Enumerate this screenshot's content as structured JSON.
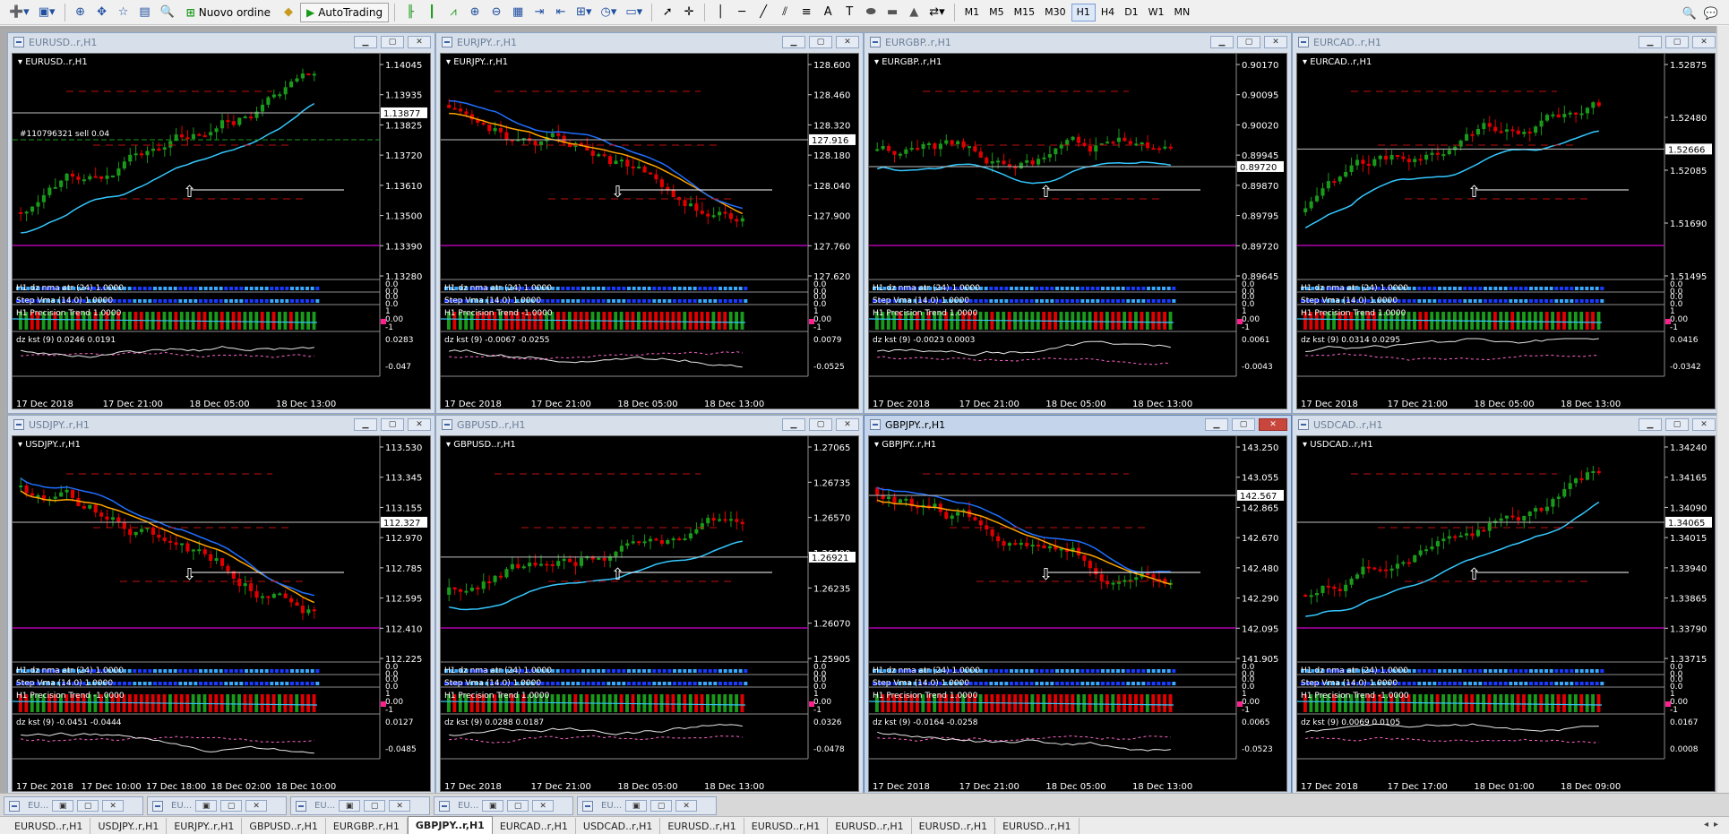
{
  "toolbar": {
    "new_order": "Nuovo ordine",
    "autotrading": "AutoTrading",
    "timeframes": [
      "M1",
      "M5",
      "M15",
      "M30",
      "H1",
      "H4",
      "D1",
      "W1",
      "MN"
    ],
    "active_timeframe": "H1"
  },
  "windows": [
    {
      "title": "EURUSD..r,H1",
      "chart_symbol": "EURUSD..r,H1",
      "bid": "1.13877",
      "prices": [
        "1.14045",
        "1.13935",
        "1.13825",
        "1.13720",
        "1.13610",
        "1.13500",
        "1.13390",
        "1.13280"
      ],
      "order_label": "#110796321 sell 0.04",
      "ind1": "H1 dz nma atr (24) 1.0000",
      "ind1_v": [
        "0.0",
        "0.0"
      ],
      "ind2": "Step Vma (14.0) 1.0000",
      "ind2_v": [
        "0.0",
        "0.0"
      ],
      "ind3": "H1 Precision Trend 1.0000",
      "ind3_v": [
        "1",
        "0.00",
        "-1"
      ],
      "ind4": "dz kst (9) 0.0246 0.0191",
      "ind4_v": [
        "0.0283",
        "-0.047"
      ],
      "dates": [
        "17 Dec 2018",
        "17 Dec 21:00",
        "18 Dec 05:00",
        "18 Dec 13:00"
      ]
    },
    {
      "title": "EURJPY..r,H1",
      "chart_symbol": "EURJPY..r,H1",
      "bid": "127.916",
      "prices": [
        "128.600",
        "128.460",
        "128.320",
        "128.180",
        "128.040",
        "127.900",
        "127.760",
        "127.620"
      ],
      "ind1": "H1 dz nma atr (24) 1.0000",
      "ind1_v": [
        "0.0",
        "0.0"
      ],
      "ind2": "Step Vma (14.0) 1.0000",
      "ind2_v": [
        "0.0",
        "0.0"
      ],
      "ind3": "H1 Precision Trend -1.0000",
      "ind3_v": [
        "1",
        "0.00",
        "-1"
      ],
      "ind4": "dz kst (9) -0.0067 -0.0255",
      "ind4_v": [
        "0.0079",
        "-0.0525"
      ],
      "dates": [
        "17 Dec 2018",
        "17 Dec 21:00",
        "18 Dec 05:00",
        "18 Dec 13:00"
      ]
    },
    {
      "title": "EURGBP..r,H1",
      "chart_symbol": "EURGBP..r,H1",
      "bid": "0.89720",
      "prices": [
        "0.90170",
        "0.90095",
        "0.90020",
        "0.89945",
        "0.89870",
        "0.89795",
        "0.89720",
        "0.89645"
      ],
      "ind1": "H1 dz nma atr (24) 1.0000",
      "ind1_v": [
        "0.0",
        "0.0"
      ],
      "ind2": "Step Vma (14.0) 1.0000",
      "ind2_v": [
        "0.0",
        "0.0"
      ],
      "ind3": "H1 Precision Trend 1.0000",
      "ind3_v": [
        "1",
        "0.00",
        "-1"
      ],
      "ind4": "dz kst (9) -0.0023 0.0003",
      "ind4_v": [
        "0.0061",
        "-0.0043"
      ],
      "dates": [
        "17 Dec 2018",
        "17 Dec 21:00",
        "18 Dec 05:00",
        "18 Dec 13:00"
      ]
    },
    {
      "title": "EURCAD..r,H1",
      "chart_symbol": "EURCAD..r,H1",
      "bid": "1.52666",
      "prices": [
        "1.52875",
        "1.52480",
        "1.52085",
        "1.51690",
        "1.51495"
      ],
      "ind1": "H1 dz nma atr (24) 1.0000",
      "ind1_v": [
        "0.0",
        "0.0"
      ],
      "ind2": "Step Vma (14.0) 1.0000",
      "ind2_v": [
        "0.0",
        "0.0"
      ],
      "ind3": "H1 Precision Trend 1.0000",
      "ind3_v": [
        "1",
        "0.00",
        "-1"
      ],
      "ind4": "dz kst (9) 0.0314 0.0295",
      "ind4_v": [
        "0.0416",
        "-0.0342"
      ],
      "dates": [
        "17 Dec 2018",
        "17 Dec 21:00",
        "18 Dec 05:00",
        "18 Dec 13:00"
      ]
    },
    {
      "title": "USDJPY..r,H1",
      "chart_symbol": "USDJPY..r,H1",
      "bid": "112.327",
      "prices": [
        "113.530",
        "113.345",
        "113.155",
        "112.970",
        "112.785",
        "112.595",
        "112.410",
        "112.225"
      ],
      "ind1": "H1 dz nma atr (24) 1.0000",
      "ind1_v": [
        "0.0",
        "0.0"
      ],
      "ind2": "Step Vma (14.0) 1.0000",
      "ind2_v": [
        "0.0",
        "0.0"
      ],
      "ind3": "H1 Precision Trend -1.0000",
      "ind3_v": [
        "1",
        "0.00",
        "-1"
      ],
      "ind4": "dz kst (9) -0.0451 -0.0444",
      "ind4_v": [
        "0.0127",
        "-0.0485"
      ],
      "dates": [
        "17 Dec 2018",
        "17 Dec 10:00",
        "17 Dec 18:00",
        "18 Dec 02:00",
        "18 Dec 10:00"
      ]
    },
    {
      "title": "GBPUSD..r,H1",
      "chart_symbol": "GBPUSD..r,H1",
      "bid": "1.26921",
      "prices": [
        "1.27065",
        "1.26735",
        "1.26570",
        "1.26400",
        "1.26235",
        "1.26070",
        "1.25905"
      ],
      "ind1": "H1 dz nma atr (24) 1.0000",
      "ind1_v": [
        "0.0",
        "0.0"
      ],
      "ind2": "Step Vma (14.0) 1.0000",
      "ind2_v": [
        "0.0",
        "0.0"
      ],
      "ind3": "H1 Precision Trend 1.0000",
      "ind3_v": [
        "1",
        "0.00",
        "-1"
      ],
      "ind4": "dz kst (9) 0.0288 0.0187",
      "ind4_v": [
        "0.0326",
        "-0.0478"
      ],
      "dates": [
        "17 Dec 2018",
        "17 Dec 21:00",
        "18 Dec 05:00",
        "18 Dec 13:00"
      ]
    },
    {
      "title": "GBPJPY..r,H1",
      "chart_symbol": "GBPJPY..r,H1",
      "bid": "142.567",
      "prices": [
        "143.250",
        "143.055",
        "142.865",
        "142.670",
        "142.480",
        "142.290",
        "142.095",
        "141.905"
      ],
      "ind1": "H1 dz nma atr (24) 1.0000",
      "ind1_v": [
        "0.0",
        "0.0"
      ],
      "ind2": "Step Vma (14.0) 1.0000",
      "ind2_v": [
        "0.0",
        "0.0"
      ],
      "ind3": "H1 Precision Trend 1.0000",
      "ind3_v": [
        "1",
        "0.00",
        "-1"
      ],
      "ind4": "dz kst (9) -0.0164 -0.0258",
      "ind4_v": [
        "0.0065",
        "-0.0523"
      ],
      "dates": [
        "17 Dec 2018",
        "17 Dec 21:00",
        "18 Dec 05:00",
        "18 Dec 13:00"
      ]
    },
    {
      "title": "USDCAD..r,H1",
      "chart_symbol": "USDCAD..r,H1",
      "bid": "1.34065",
      "prices": [
        "1.34240",
        "1.34165",
        "1.34090",
        "1.34015",
        "1.33940",
        "1.33865",
        "1.33790",
        "1.33715"
      ],
      "ind1": "H1 dz nma atr (24) 1.0000",
      "ind1_v": [
        "0.0",
        "0.0"
      ],
      "ind2": "Step Vma (14.0) 1.0000",
      "ind2_v": [
        "0.0",
        "0.0"
      ],
      "ind3": "H1 Precision Trend -1.0000",
      "ind3_v": [
        "1",
        "0.00",
        "-1"
      ],
      "ind4": "dz kst (9) 0.0069 0.0105",
      "ind4_v": [
        "0.0167",
        "0.0008"
      ],
      "dates": [
        "17 Dec 2018",
        "17 Dec 17:00",
        "18 Dec 01:00",
        "18 Dec 09:00"
      ]
    }
  ],
  "minimized": [
    "EU...",
    "EU...",
    "EU...",
    "EU...",
    "EU..."
  ],
  "symbol_tabs": [
    "EURUSD..r,H1",
    "USDJPY..r,H1",
    "EURJPY..r,H1",
    "GBPUSD..r,H1",
    "EURGBP..r,H1",
    "GBPJPY..r,H1",
    "EURCAD..r,H1",
    "USDCAD..r,H1",
    "EURUSD..r,H1",
    "EURUSD..r,H1",
    "EURUSD..r,H1",
    "EURUSD..r,H1",
    "EURUSD..r,H1"
  ],
  "active_symbol_tab": "GBPJPY..r,H1",
  "colors": {
    "bull": "#1a9a1a",
    "bear": "#e00000",
    "magenta": "#d000d0",
    "ma_fast": "#1f6fff",
    "ma_cyan": "#34c8ff",
    "ma_orange": "#ffa500",
    "chart_bg": "#000000"
  }
}
